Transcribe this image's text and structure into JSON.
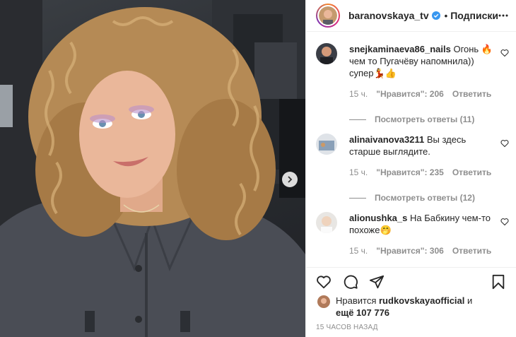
{
  "post": {
    "username": "baranovskaya_tv",
    "follow_label": "Подписки",
    "dot": "•",
    "time_ago": "15 часов назад"
  },
  "comments": [
    {
      "user": "snejkaminaeva86_nails",
      "text": "Огонь 🔥 чем то Пугачёву напомнила)) супер💃👍",
      "time": "15 ч.",
      "likes": "\"Нравится\": 206",
      "reply": "Ответить",
      "view_replies": "Посмотреть ответы (11)"
    },
    {
      "user": "alinaivanova3211",
      "text": "Вы здесь старше выглядите.",
      "time": "15 ч.",
      "likes": "\"Нравится\": 235",
      "reply": "Ответить",
      "view_replies": "Посмотреть ответы (12)"
    },
    {
      "user": "alionushka_s",
      "text": "На Бабкину чем-то похоже🤭",
      "time": "15 ч.",
      "likes": "\"Нравится\": 306",
      "reply": "Ответить"
    }
  ],
  "liked_by": {
    "prefix": "Нравится",
    "user": "rudkovskayaofficial",
    "conj": "и",
    "others": "ещё 107 776"
  },
  "colors": {
    "verified": "#3897f0",
    "meta_gray": "#8e8e8e",
    "border": "#efefef"
  },
  "icons": [
    "like-icon",
    "comment-icon",
    "share-icon",
    "bookmark-icon",
    "more-icon",
    "next-arrow-icon",
    "verified-badge-icon",
    "heart-icon"
  ]
}
